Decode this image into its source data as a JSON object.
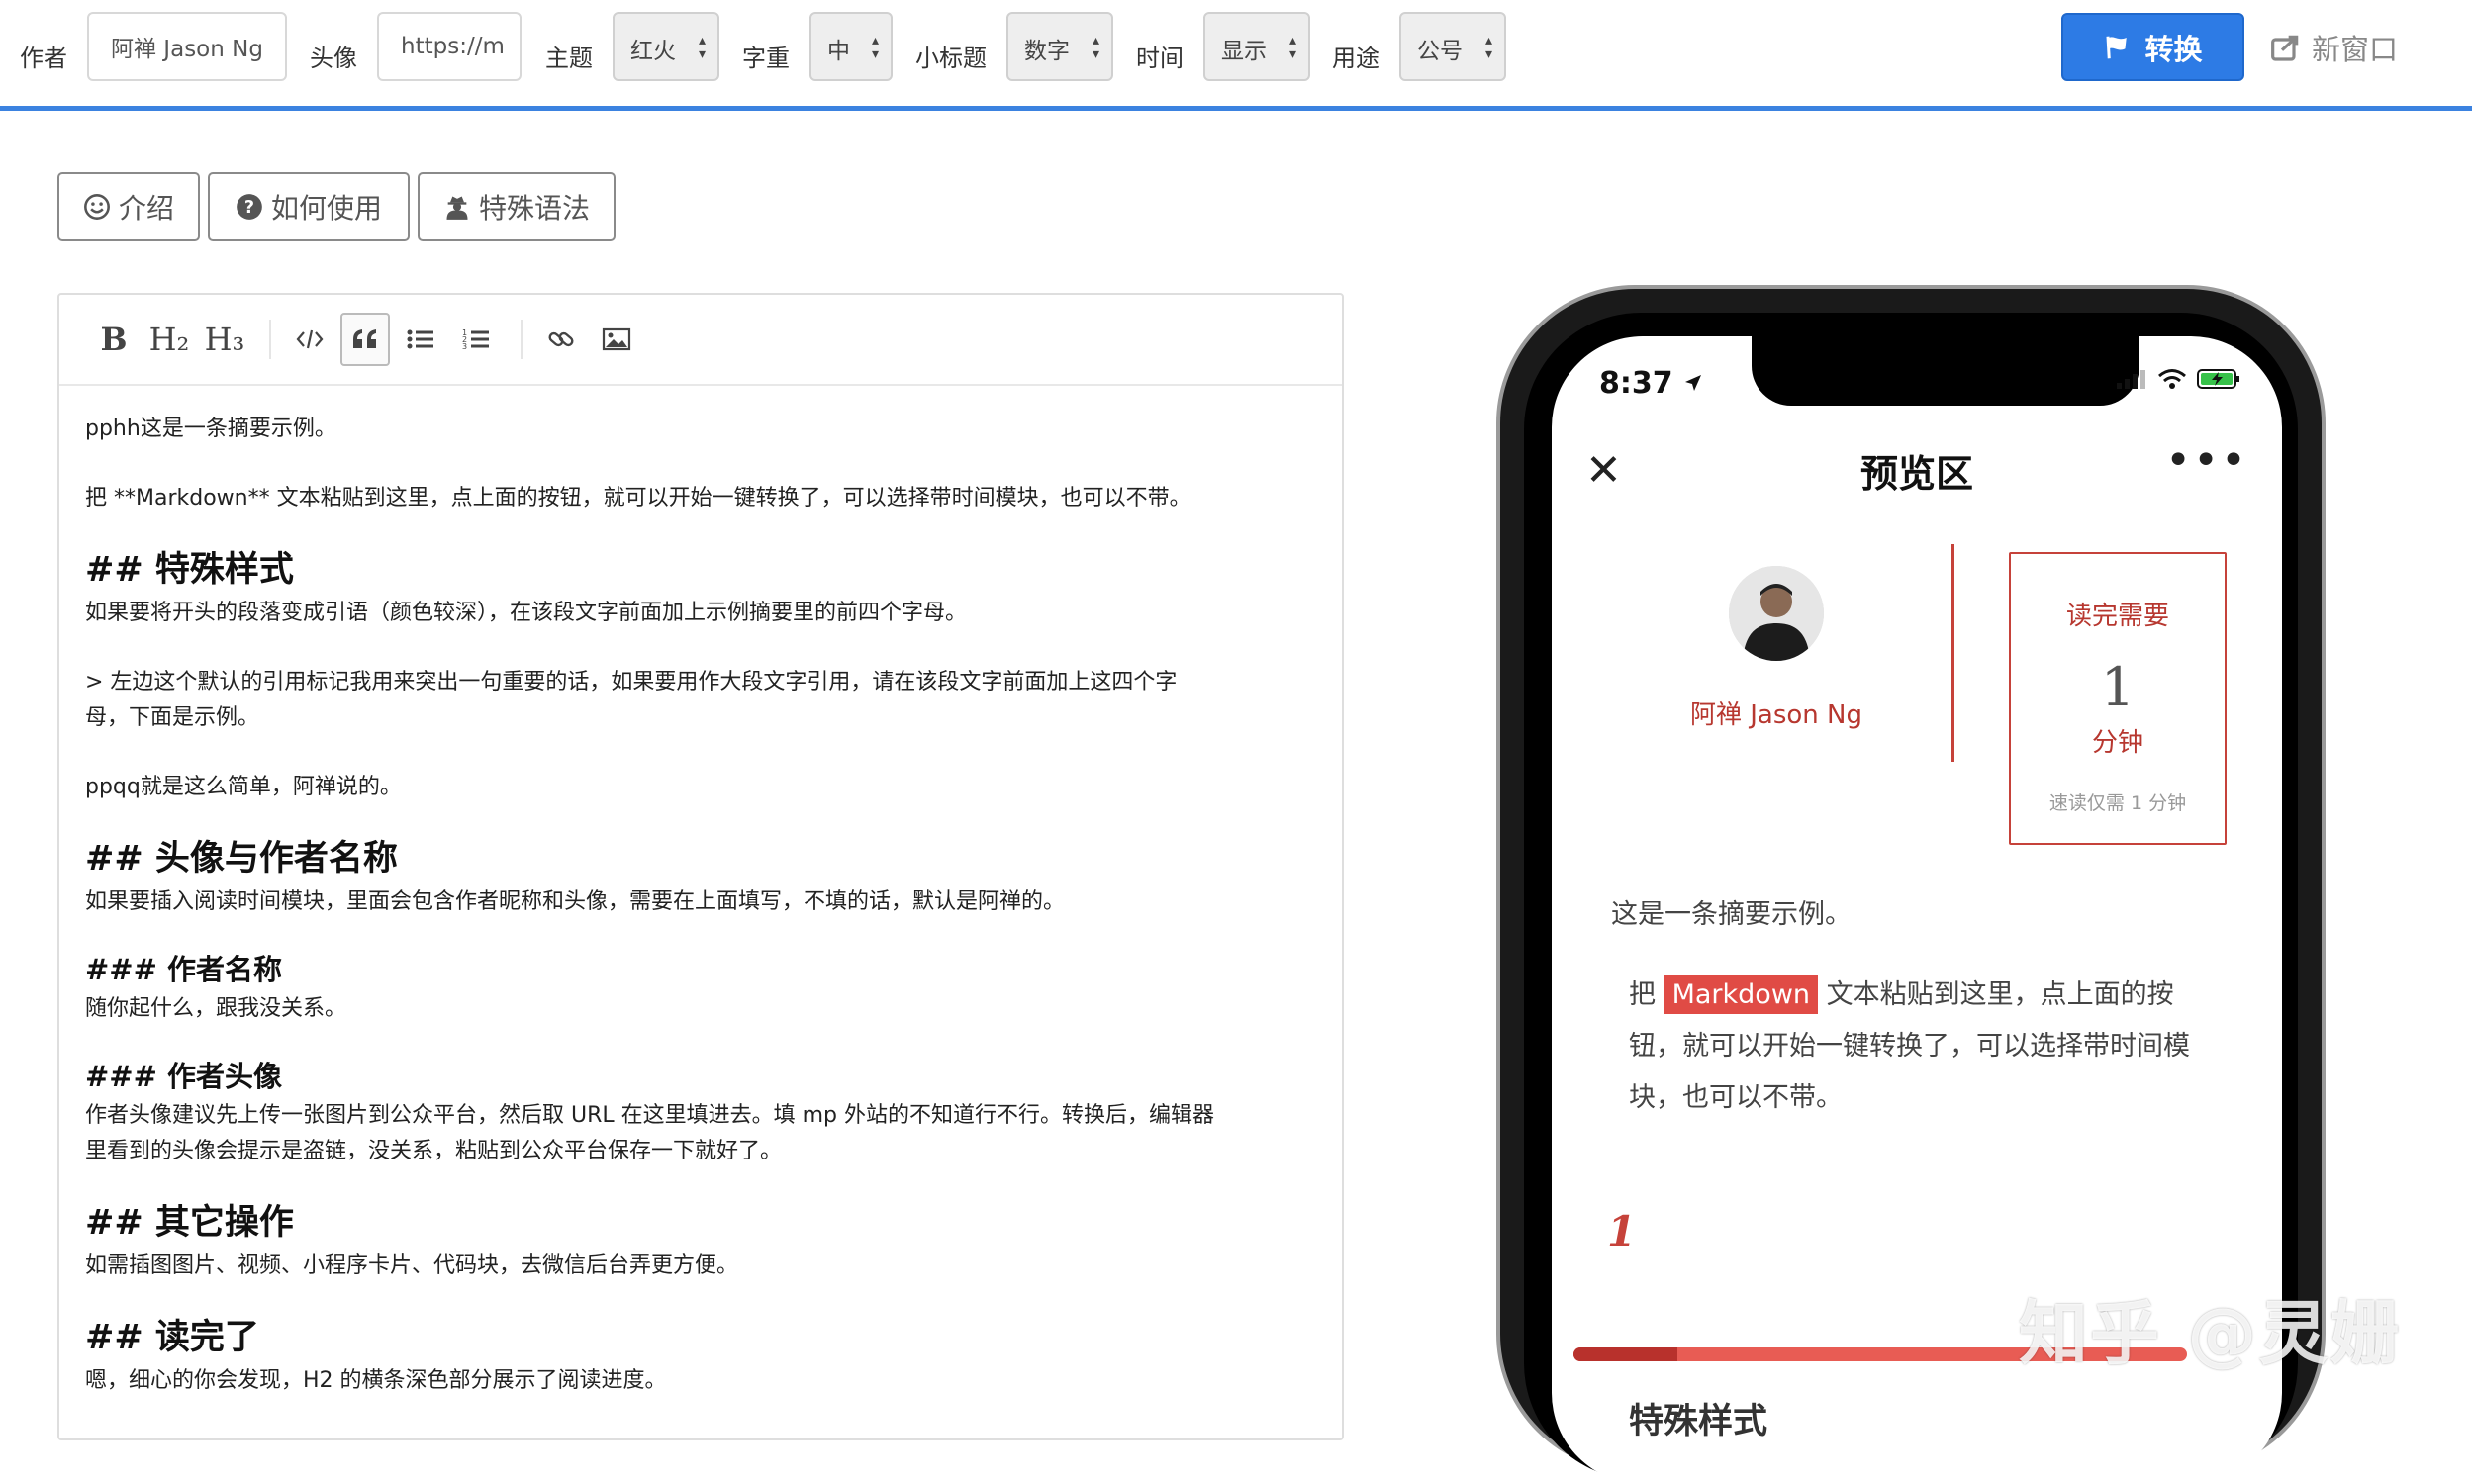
{
  "toolbar": {
    "author_label": "作者",
    "author_value": "阿禅 Jason Ng",
    "avatar_label": "头像",
    "avatar_value": "https://m",
    "theme_label": "主题",
    "theme_value": "红火",
    "weight_label": "字重",
    "weight_value": "中",
    "subtitle_label": "小标题",
    "subtitle_value": "数字",
    "time_label": "时间",
    "time_value": "显示",
    "purpose_label": "用途",
    "purpose_value": "公号",
    "convert_label": "转换",
    "newwin_label": "新窗口"
  },
  "tabs": [
    {
      "label": "介绍",
      "icon": "smile-icon"
    },
    {
      "label": "如何使用",
      "icon": "question-circle-icon"
    },
    {
      "label": "特殊语法",
      "icon": "user-secret-icon"
    }
  ],
  "editor": {
    "tools": [
      "B",
      "H₂",
      "H₃"
    ],
    "lines": {
      "l1": "pphh这是一条摘要示例。",
      "l2": "把 **Markdown** 文本粘贴到这里，点上面的按钮，就可以开始一键转换了，可以选择带时间模块，也可以不带。",
      "h2a": "## 特殊样式",
      "l3": "如果要将开头的段落变成引语（颜色较深），在该段文字前面加上示例摘要里的前四个字母。",
      "l4": "> 左边这个默认的引用标记我用来突出一句重要的话，如果要用作大段文字引用，请在该段文字前面加上这四个字\n母，下面是示例。",
      "l5": "ppqq就是这么简单，阿禅说的。",
      "h2b": "## 头像与作者名称",
      "l6": "如果要插入阅读时间模块，里面会包含作者昵称和头像，需要在上面填写，不填的话，默认是阿禅的。",
      "h3a": "### 作者名称",
      "l7": "随你起什么，跟我没关系。",
      "h3b": "### 作者头像",
      "l8": "作者头像建议先上传一张图片到公众平台，然后取 URL 在这里填进去。填 mp 外站的不知道行不行。转换后，编辑器\n里看到的头像会提示是盗链，没关系，粘贴到公众平台保存一下就好了。",
      "h2c": "## 其它操作",
      "l9": "如需插图图片、视频、小程序卡片、代码块，去微信后台弄更方便。",
      "h2d": "## 读完了",
      "l10": "嗯，细心的你会发现，H2 的横条深色部分展示了阅读进度。"
    }
  },
  "preview": {
    "status_time": "8:37",
    "nav_title": "预览区",
    "nav_more": "•••",
    "author_name": "阿禅 Jason Ng",
    "read_title": "读完需要",
    "read_num": "1",
    "read_unit": "分钟",
    "read_note": "速读仅需 1 分钟",
    "summary": "这是一条摘要示例。",
    "body_pre": "把 ",
    "body_hl": "Markdown",
    "body_post": " 文本粘贴到这里，点上面的按钮，就可以开始一键转换了，可以选择带时间模块，也可以不带。",
    "section_num": "1",
    "section_title": "特殊样式",
    "progress": 0.17
  },
  "watermark": "知乎 @灵姗",
  "colors": {
    "accent": "#2d7be5",
    "theme_red": "#c6423a"
  }
}
